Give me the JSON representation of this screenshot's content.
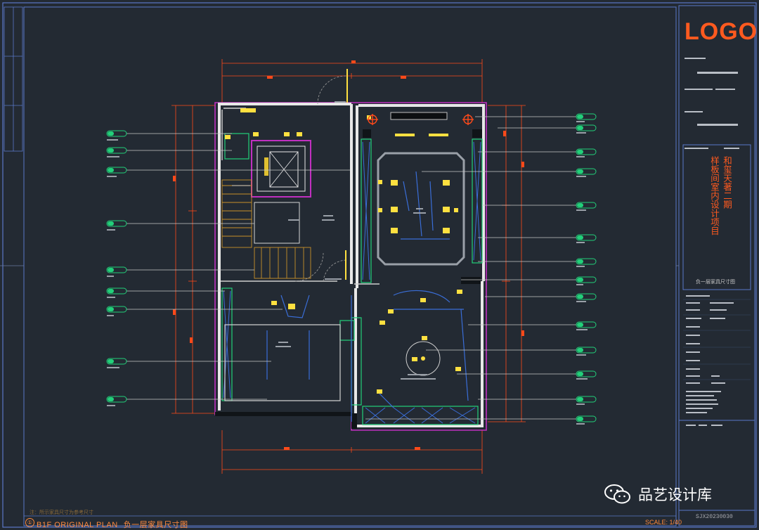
{
  "logo": "LOGO",
  "project_title": [
    "和玺天著二期",
    "样板间室内设计项目"
  ],
  "drawing_name_cn": "负一层家具尺寸图",
  "plan_label_en": "B1F ORIGINAL PLAN",
  "plan_label_cn": "负一层家具尺寸图",
  "plan_number": "①",
  "note": "注：所示家具尺寸为参考尺寸",
  "scale": "SCALE: 1/40",
  "drawing_code": "SJX20230030",
  "watermark": "品艺设计库",
  "icons": {
    "wechat": "wechat-icon"
  },
  "colors": {
    "background": "#232a33",
    "frame": "#5a78c8",
    "wall": "#e8e8e8",
    "magenta": "#c030c0",
    "dimension": "#ff4a1a",
    "tag": "#22d07a",
    "fixture": "#ffe040",
    "furniture": "#3a6ed8",
    "brand": "#ff5a1f"
  }
}
